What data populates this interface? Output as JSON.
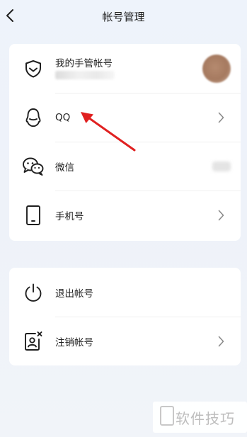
{
  "header": {
    "title": "帐号管理"
  },
  "accounts": {
    "my_account_label": "我的手管帐号",
    "qq_label": "QQ",
    "wechat_label": "微信",
    "phone_label": "手机号"
  },
  "actions": {
    "logout_label": "退出帐号",
    "cancel_label": "注销帐号"
  },
  "watermark": {
    "text": "软件技巧"
  },
  "icons": {
    "back": "chevron-left-icon",
    "shield": "shield-icon",
    "qq": "qq-icon",
    "wechat": "wechat-icon",
    "phone": "phone-icon",
    "power": "power-icon",
    "cancel": "user-remove-icon",
    "chevron": "chevron-right-icon",
    "annotation": "red-arrow"
  },
  "colors": {
    "annotation_arrow": "#e02020",
    "background": "#eef3fb"
  }
}
